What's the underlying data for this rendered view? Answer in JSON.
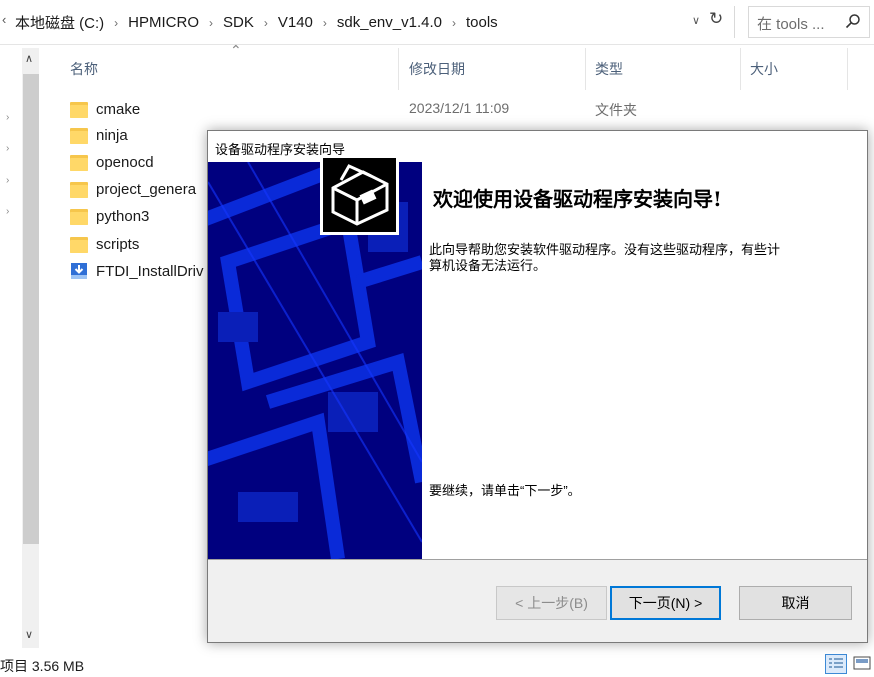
{
  "address_bar": {
    "back_glyph": "‹",
    "breadcrumb": [
      "本地磁盘 (C:)",
      "HPMICRO",
      "SDK",
      "V140",
      "sdk_env_v1.4.0",
      "tools"
    ],
    "separator": "›",
    "dropdown_icon": "chevron-down-icon",
    "refresh_icon": "refresh-icon"
  },
  "search": {
    "placeholder": "在 tools ...",
    "icon": "search-icon"
  },
  "columns": {
    "name": "名称",
    "modified": "修改日期",
    "type": "类型",
    "size": "大小"
  },
  "files": [
    {
      "name": "cmake",
      "icon": "folder-icon",
      "date": "2023/12/1 11:09",
      "type": "文件夹"
    },
    {
      "name": "ninja",
      "icon": "folder-icon"
    },
    {
      "name": "openocd",
      "icon": "folder-icon"
    },
    {
      "name": "project_genera",
      "icon": "folder-icon"
    },
    {
      "name": "python3",
      "icon": "folder-icon"
    },
    {
      "name": "scripts",
      "icon": "folder-icon"
    },
    {
      "name": "FTDI_InstallDriv",
      "icon": "installer-icon"
    }
  ],
  "status_bar": {
    "text": "项目  3.56 MB"
  },
  "dialog": {
    "title": "设备驱动程序安装向导",
    "heading": "欢迎使用设备驱动程序安装向导!",
    "intro": "此向导帮助您安装软件驱动程序。没有这些驱动程序，有些计算机设备无法运行。",
    "continue_text": "要继续，请单击“下一步”。",
    "buttons": {
      "back": "< 上一步(B)",
      "next": "下一页(N) >",
      "cancel": "取消"
    }
  },
  "colors": {
    "banner_blue": "#00007f",
    "accent": "#0078d7",
    "folder": "#ffd868"
  }
}
